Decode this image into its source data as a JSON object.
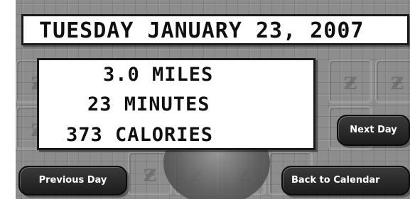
{
  "date": {
    "text": "TUESDAY JANUARY 23, 2007"
  },
  "stats": {
    "miles": "3.0 MILES",
    "minutes": "23 MINUTES",
    "calories": "373 CALORIES"
  },
  "buttons": {
    "next_day": "Next Day",
    "previous_day": "Previous Day",
    "back_to_calendar": "Back to Calendar"
  },
  "background": {
    "tile_icon": "z-logo-tile-icon",
    "color": "#8d8d8d"
  }
}
